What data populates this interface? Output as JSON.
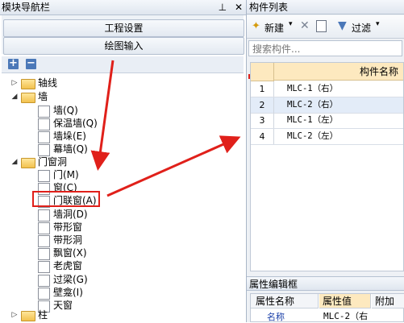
{
  "left_panel": {
    "title": "模块导航栏",
    "pin_icon": "pin-icon",
    "close_icon": "close-icon",
    "engineering_settings_label": "工程设置",
    "drawing_input_label": "绘图输入",
    "expand_all_label": "+",
    "collapse_all_label": "−"
  },
  "tree": {
    "axis": "轴线",
    "wall": "墙",
    "wall_children": [
      "墙(Q)",
      "保温墙(Q)",
      "墙垛(E)",
      "幕墙(Q)"
    ],
    "door_window": "门窗洞",
    "door_window_children": [
      "门(M)",
      "窗(C)",
      "门联窗(A)",
      "墙洞(D)",
      "带形窗",
      "带形洞",
      "飘窗(X)",
      "老虎窗",
      "过梁(G)",
      "壁龛(I)",
      "天窗"
    ],
    "column": "柱"
  },
  "right_panel": {
    "title": "构件列表",
    "new_button": "新建",
    "filter_button": "过滤",
    "search_placeholder": "搜索构件...",
    "column_header": "构件名称",
    "rows": [
      {
        "num": "1",
        "name": "MLC-1（右）"
      },
      {
        "num": "2",
        "name": "MLC-2（右）"
      },
      {
        "num": "3",
        "name": "MLC-1（左）"
      },
      {
        "num": "4",
        "name": "MLC-2（左）"
      }
    ],
    "selected_row": "2"
  },
  "property_panel": {
    "title": "属性编辑框",
    "headers": [
      "属性名称",
      "属性值",
      "附加"
    ],
    "row_name": "名称",
    "row_value": "MLC-2（右"
  },
  "colors": {
    "accent_red": "#e0201a",
    "header_yellow": "#fde9bf",
    "selected_row": "#e3ecf8"
  }
}
